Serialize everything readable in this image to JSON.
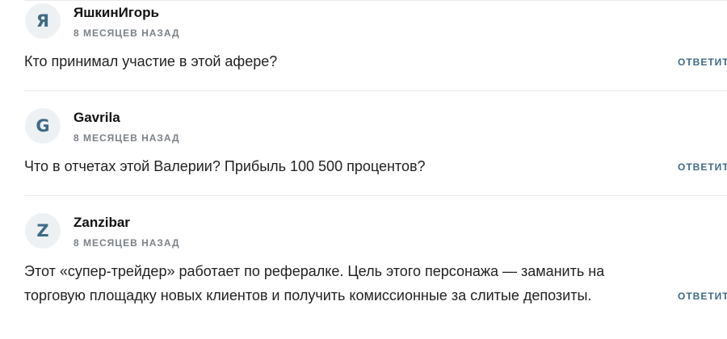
{
  "comments": [
    {
      "avatar_letter": "Я",
      "author": "ЯшкинИгорь",
      "date": "8 МЕСЯЦЕВ НАЗАД",
      "lines": [
        "Кто принимал участие в этой афере?"
      ],
      "reply_label": "ОТВЕТИТ"
    },
    {
      "avatar_letter": "G",
      "author": "Gavrila",
      "date": "8 МЕСЯЦЕВ НАЗАД",
      "lines": [
        "Что в отчетах этой Валерии? Прибыль 100 500 процентов?"
      ],
      "reply_label": "ОТВЕТИТ"
    },
    {
      "avatar_letter": "Z",
      "author": "Zanzibar",
      "date": "8 МЕСЯЦЕВ НАЗАД",
      "lines": [
        "Этот «супер-трейдер» работает по рефералке. Цель этого персонажа — заманить на",
        "торговую площадку новых клиентов и получить комиссионные за слитые депозиты."
      ],
      "reply_label": "ОТВЕТИТ"
    }
  ]
}
